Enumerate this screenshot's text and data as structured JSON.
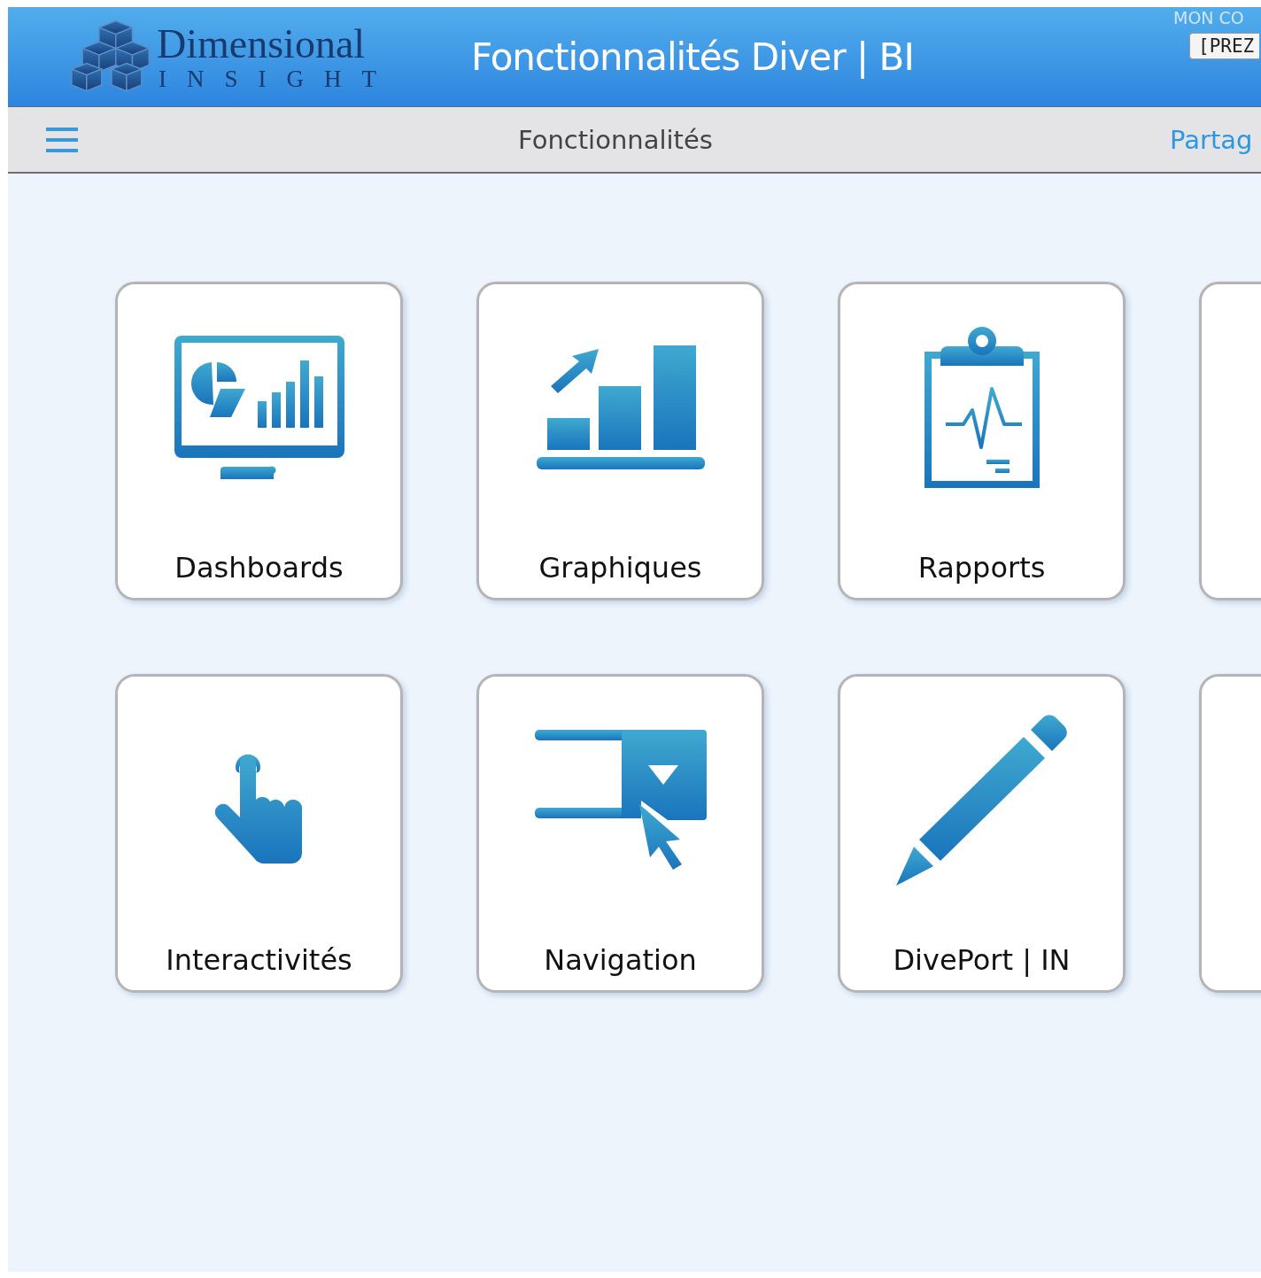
{
  "header": {
    "logo": {
      "name": "Dimensional",
      "tagline": "INSIGHT"
    },
    "title": "Fonctionnalités Diver | BI",
    "user": "MON CO",
    "button": "[PREZ"
  },
  "toolbar": {
    "title": "Fonctionnalités",
    "share": "Partag"
  },
  "tiles": [
    {
      "kind": "dashboard",
      "label": "Dashboards"
    },
    {
      "kind": "chart",
      "label": "Graphiques"
    },
    {
      "kind": "report",
      "label": "Rapports"
    },
    {
      "kind": "blank"
    },
    {
      "kind": "touch",
      "label": "Interactivités"
    },
    {
      "kind": "navigation",
      "label": "Navigation"
    },
    {
      "kind": "pencil",
      "label": "DivePort | IN"
    },
    {
      "kind": "blank"
    }
  ]
}
